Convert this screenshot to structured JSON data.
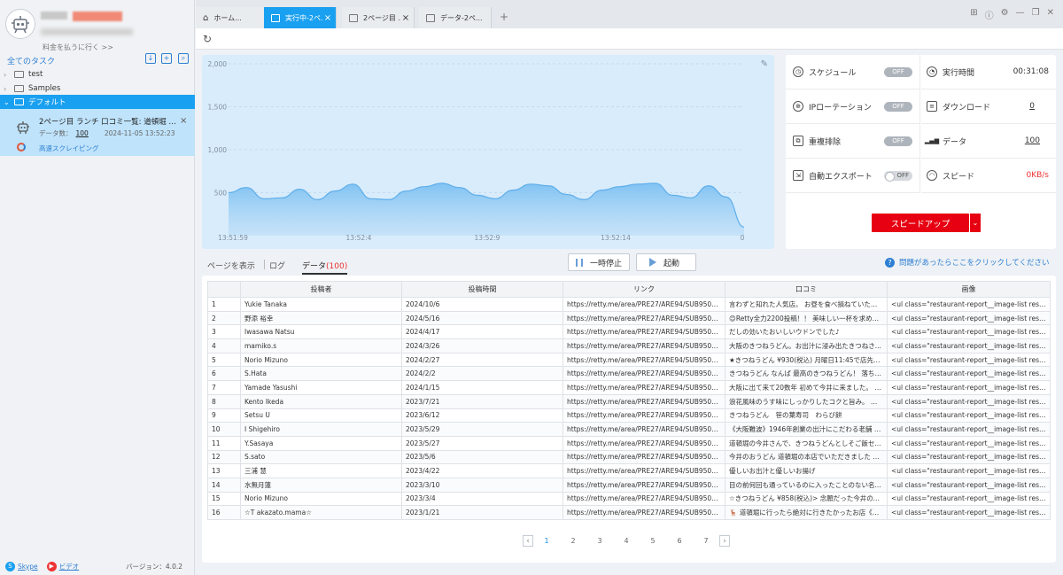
{
  "sidebar": {
    "pay_link": "料金を払うに行く >>",
    "all_tasks": "全てのタスク",
    "tree": [
      {
        "label": "test",
        "active": false
      },
      {
        "label": "Samples",
        "active": false
      },
      {
        "label": "デフォルト",
        "active": true
      }
    ],
    "task": {
      "name": "2ページ目 ランチ 口コミ一覧: 道頓堀 今井...",
      "count_label": "データ数：",
      "count": "100",
      "date": "2024-11-05 13:52:23",
      "mode": "高速スクレイピング"
    },
    "footer": {
      "skype": "Skype",
      "video": "ビデオ",
      "version": "バージョン：4.0.2"
    }
  },
  "tabs": [
    {
      "label": "ホーム...",
      "active": false
    },
    {
      "label": "実行中-2ペ...",
      "active": true
    },
    {
      "label": "2ページ目 ...",
      "active": false
    },
    {
      "label": "データ-2ペ...",
      "active": false
    }
  ],
  "stats": {
    "schedule": {
      "label": "スケジュール",
      "toggle": "OFF"
    },
    "runtime": {
      "label": "実行時間",
      "value": "00:31:08"
    },
    "ip": {
      "label": "IPローテーション",
      "toggle": "OFF"
    },
    "download": {
      "label": "ダウンロード",
      "value": "0"
    },
    "dedupe": {
      "label": "重複排除",
      "toggle": "OFF"
    },
    "data": {
      "label": "データ",
      "value": "100"
    },
    "export": {
      "label": "自動エクスポート",
      "toggle": "OFF"
    },
    "speed": {
      "label": "スピード",
      "value": "0KB/s"
    },
    "speedup": "スピードアップ"
  },
  "subtabs": {
    "page": "ページを表示",
    "log": "ログ",
    "data": "データ",
    "data_count": "(100)"
  },
  "controls": {
    "pause": "一時停止",
    "start": "起動",
    "help": "問題があったらここをクリックしてください"
  },
  "chart_data": {
    "type": "area",
    "x": [
      "13:51:59",
      "13:52:4",
      "13:52:9",
      "13:52:14"
    ],
    "x_end_label": "0",
    "yticks": [
      "2,000",
      "1,500",
      "1,000",
      "500"
    ],
    "ylim": [
      0,
      2000
    ],
    "values": [
      500,
      560,
      430,
      440,
      540,
      420,
      520,
      600,
      430,
      420,
      520,
      570,
      610,
      560,
      470,
      430,
      530,
      600,
      580,
      480,
      420,
      530,
      570,
      600,
      610,
      470,
      440,
      580,
      450,
      100
    ],
    "grid": true,
    "color": "#7cc0f2"
  },
  "table": {
    "headers": [
      "",
      "投稿者",
      "投稿時間",
      "リンク",
      "口コミ",
      "画像"
    ],
    "rows": [
      [
        "1",
        "Yukie Tanaka",
        "2024/10/6",
        "https://retty.me/area/PRE27/ARE94/SUB9502/1000...",
        "言わずと知れた人気店。 お昼を食べ損ねていたら...",
        "<ul class=\"restaurant-report__image-list restaurant-..."
      ],
      [
        "2",
        "野添 裕幸",
        "2024/5/16",
        "https://retty.me/area/PRE27/ARE94/SUB9502/1000...",
        "😊Retty全力2200投稿！！ 美味しい一杯を求めて日...",
        "<ul class=\"restaurant-report__image-list restaurant-..."
      ],
      [
        "3",
        "Iwasawa Natsu",
        "2024/4/17",
        "https://retty.me/area/PRE27/ARE94/SUB9502/1000...",
        "だしの効いたおいしいウドンでした♪",
        "<ul class=\"restaurant-report__image-list restaurant-..."
      ],
      [
        "4",
        "mamiko.s",
        "2024/3/26",
        "https://retty.me/area/PRE27/ARE94/SUB9502/1000...",
        "大阪のきつねうどん。お出汁に浸み出たきつねさ...",
        "<ul class=\"restaurant-report__image-list restaurant-..."
      ],
      [
        "5",
        "Norio Mizuno",
        "2024/2/27",
        "https://retty.me/area/PRE27/ARE94/SUB9502/1000...",
        "★きつねうどん ¥930(税込) 月曜日11:45で店先に待...",
        "<ul class=\"restaurant-report__image-list restaurant-..."
      ],
      [
        "6",
        "S.Hata",
        "2024/2/2",
        "https://retty.me/area/PRE27/ARE94/SUB9502/1000...",
        "きつねうどん なんば 最高のきつねうどん！ 落ち着...",
        "<ul class=\"restaurant-report__image-list restaurant-..."
      ],
      [
        "7",
        "Yamade Yasushi",
        "2024/1/15",
        "https://retty.me/area/PRE27/ARE94/SUB9502/1000...",
        "大阪に出て来て20数年 初めて今井に来ました。 自...",
        "<ul class=\"restaurant-report__image-list restaurant-..."
      ],
      [
        "8",
        "Kento Ikeda",
        "2023/7/21",
        "https://retty.me/area/PRE27/ARE94/SUB9502/1000...",
        "浪花風味のうす味にしっかりしたコクと旨み。 き...",
        "<ul class=\"restaurant-report__image-list restaurant-..."
      ],
      [
        "9",
        "Setsu U",
        "2023/6/12",
        "https://retty.me/area/PRE27/ARE94/SUB9502/1000...",
        "きつねうどん　笹の葉寿司　わらび餅",
        "<ul class=\"restaurant-report__image-list restaurant-..."
      ],
      [
        "10",
        "I Shigehiro",
        "2023/5/29",
        "https://retty.me/area/PRE27/ARE94/SUB9502/1000...",
        "《大阪難波》1946年創業の出汁にこだわる老舗 食...",
        "<ul class=\"restaurant-report__image-list restaurant-..."
      ],
      [
        "11",
        "Y.Sasaya",
        "2023/5/27",
        "https://retty.me/area/PRE27/ARE94/SUB9502/1000...",
        "道頓堀の今井さんで、きつねうどんとしそご飯セ...",
        "<ul class=\"restaurant-report__image-list restaurant-..."
      ],
      [
        "12",
        "S.sato",
        "2023/5/6",
        "https://retty.me/area/PRE27/ARE94/SUB9502/1000...",
        "今井のおうどん 道頓堀の本店でいただきました も...",
        "<ul class=\"restaurant-report__image-list restaurant-..."
      ],
      [
        "13",
        "三浦 慧",
        "2023/4/22",
        "https://retty.me/area/PRE27/ARE94/SUB9502/1000...",
        "優しいお出汁と優しいお揚げ",
        "<ul class=\"restaurant-report__image-list restaurant-..."
      ],
      [
        "14",
        "水無月蓮",
        "2023/3/10",
        "https://retty.me/area/PRE27/ARE94/SUB9502/1000...",
        "目の前何回も通っているのに入ったことのない名...",
        "<ul class=\"restaurant-report__image-list restaurant-..."
      ],
      [
        "15",
        "Norio Mizuno",
        "2023/3/4",
        "https://retty.me/area/PRE27/ARE94/SUB9502/1000...",
        "☆きつねうどん ¥858(税込)> 念願だった今井のき...",
        "<ul class=\"restaurant-report__image-list restaurant-..."
      ],
      [
        "16",
        "☆T akazato.mama☆",
        "2023/1/21",
        "https://retty.me/area/PRE27/ARE94/SUB9502/1000...",
        "🦌 道頓堀に行ったら絶対に行きたかったお店《今...",
        "<ul class=\"restaurant-report__image-list restaurant-..."
      ]
    ]
  },
  "pager": {
    "pages": [
      "1",
      "2",
      "3",
      "4",
      "5",
      "6",
      "7"
    ],
    "current": "1"
  }
}
